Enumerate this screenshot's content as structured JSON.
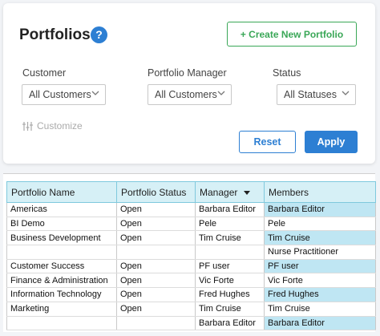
{
  "header": {
    "title": "Portfolios",
    "help_symbol": "?",
    "create_label": "+ Create New Portfolio"
  },
  "filters": [
    {
      "label": "Customer",
      "value": "All Customers"
    },
    {
      "label": "Portfolio Manager",
      "value": "All Customers"
    },
    {
      "label": "Status",
      "value": "All Statuses"
    }
  ],
  "customize_label": "Customize",
  "actions": {
    "reset_label": "Reset",
    "apply_label": "Apply"
  },
  "table": {
    "columns": [
      "Portfolio Name",
      "Portfolio Status",
      "Manager",
      "Members"
    ],
    "rows": [
      {
        "name": "Americas",
        "status": "Open",
        "manager": "Barbara Editor",
        "member": "Barbara Editor",
        "highlight": true
      },
      {
        "name": "BI Demo",
        "status": "Open",
        "manager": "Pele",
        "member": "Pele",
        "highlight": false
      },
      {
        "name": "Business Development",
        "status": "Open",
        "manager": "Tim Cruise",
        "member": "Tim Cruise",
        "highlight": true
      },
      {
        "name": "",
        "status": "",
        "manager": "",
        "member": "Nurse Practitioner",
        "highlight": false
      },
      {
        "name": "Customer Success",
        "status": "Open",
        "manager": "PF user",
        "member": "PF user",
        "highlight": true
      },
      {
        "name": "Finance & Administration",
        "status": "Open",
        "manager": "Vic Forte",
        "member": "Vic Forte",
        "highlight": false
      },
      {
        "name": "Information Technology",
        "status": "Open",
        "manager": "Fred Hughes",
        "member": "Fred Hughes",
        "highlight": true
      },
      {
        "name": "Marketing",
        "status": "Open",
        "manager": "Tim Cruise",
        "member": "Tim Cruise",
        "highlight": false
      },
      {
        "name": "",
        "status": "",
        "manager": "Barbara Editor",
        "member": "Barbara Editor",
        "highlight": true
      }
    ]
  },
  "colors": {
    "accent": "#2d7fd3",
    "create": "#3aa757",
    "header_bg": "#d6f0f6",
    "member_highlight": "#bfe6f3"
  }
}
